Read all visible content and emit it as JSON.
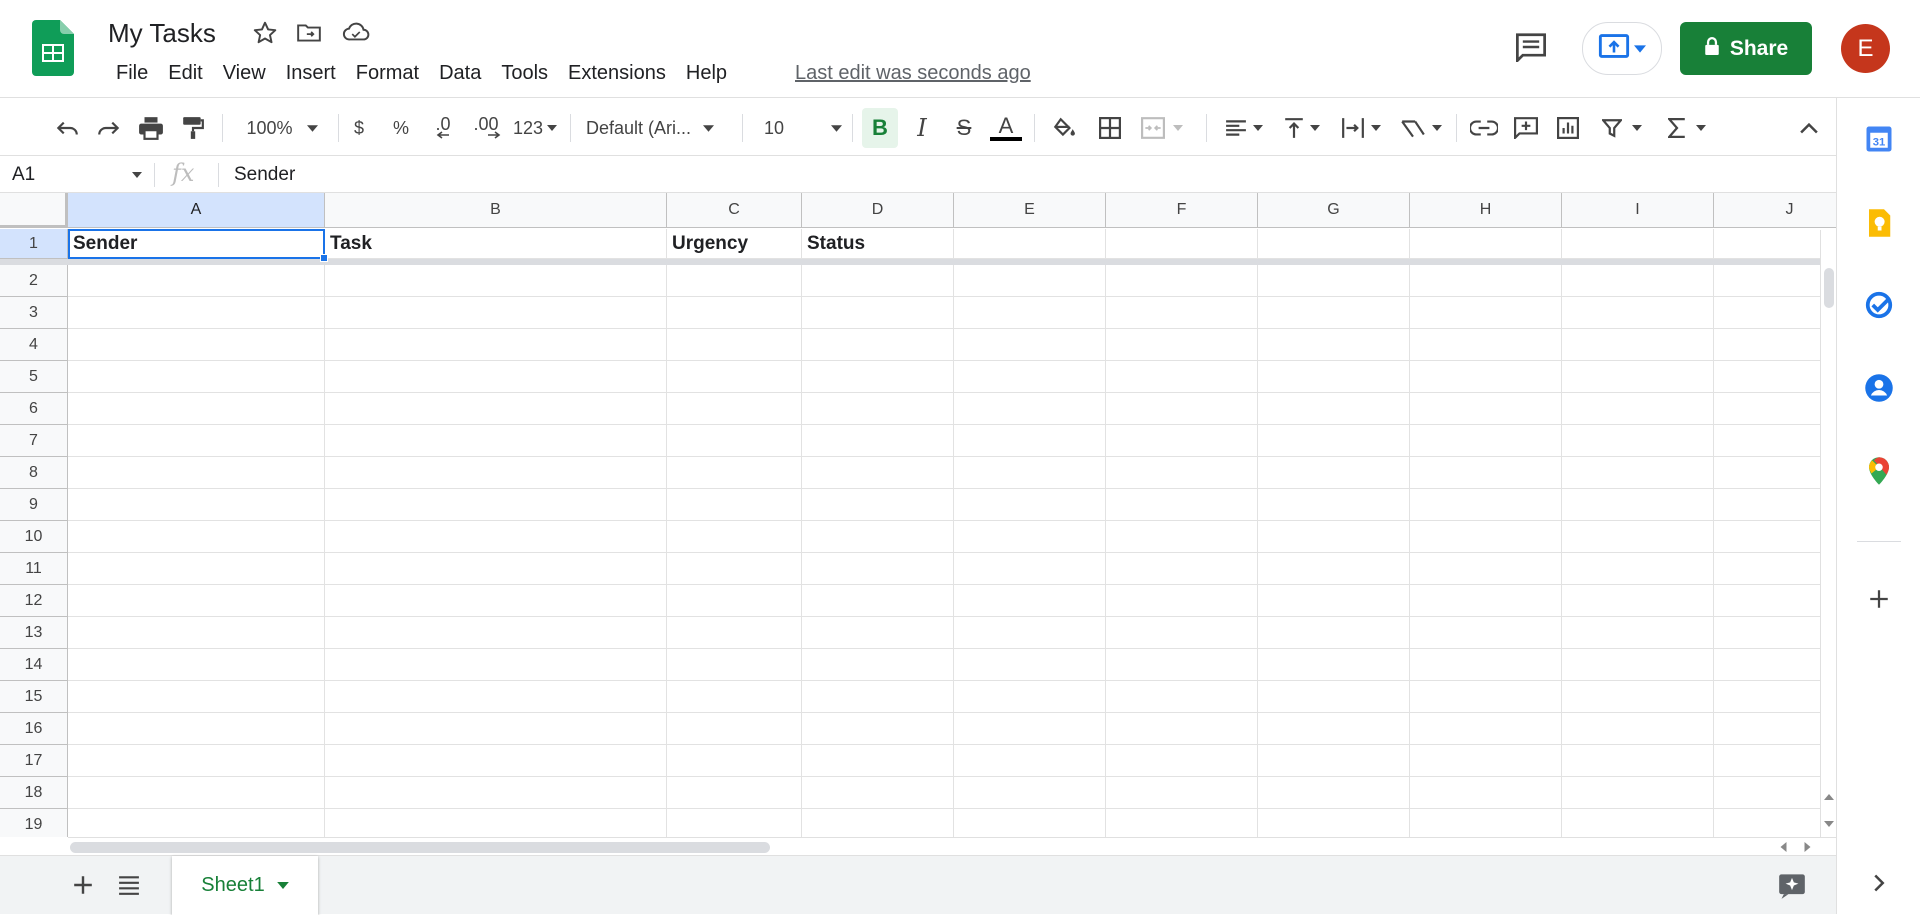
{
  "header": {
    "doc_title": "My Tasks",
    "last_edit": "Last edit was seconds ago",
    "share_label": "Share",
    "avatar_letter": "E"
  },
  "menu": [
    "File",
    "Edit",
    "View",
    "Insert",
    "Format",
    "Data",
    "Tools",
    "Extensions",
    "Help"
  ],
  "toolbar": {
    "zoom": "100%",
    "currency": "$",
    "percent": "%",
    "dec_decrease": ".0",
    "dec_increase": ".00",
    "more_formats": "123",
    "font": "Default (Ari...",
    "font_size": "10",
    "bold": "B",
    "italic": "I",
    "strike": "S",
    "text_color": "A"
  },
  "formula_bar": {
    "name_box": "A1",
    "fx": "fx",
    "value": "Sender"
  },
  "columns": [
    "A",
    "B",
    "C",
    "D",
    "E",
    "F",
    "G",
    "H",
    "I",
    "J"
  ],
  "rows": [
    "1",
    "2",
    "3",
    "4",
    "5",
    "6",
    "7",
    "8",
    "9",
    "10",
    "11",
    "12",
    "13",
    "14",
    "15",
    "16",
    "17",
    "18",
    "19"
  ],
  "cells": {
    "A1": "Sender",
    "B1": "Task",
    "C1": "Urgency",
    "D1": "Status"
  },
  "sheet_tab": "Sheet1",
  "colors": {
    "brand_green": "#188038",
    "selection_blue": "#1a73e8",
    "avatar": "#c5361c"
  }
}
